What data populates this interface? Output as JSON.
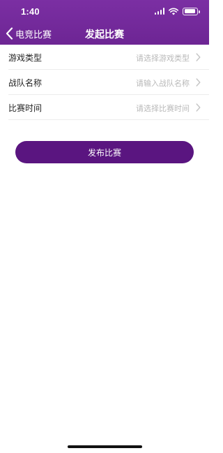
{
  "status_bar": {
    "time": "1:40",
    "icons": [
      "signal-icon",
      "wifi-icon",
      "battery-icon"
    ]
  },
  "nav": {
    "back_label": "电竞比赛",
    "title": "发起比赛"
  },
  "form": {
    "rows": [
      {
        "label": "游戏类型",
        "placeholder": "请选择游戏类型"
      },
      {
        "label": "战队名称",
        "placeholder": "请输入战队名称"
      },
      {
        "label": "比赛时间",
        "placeholder": "请选择比赛时间"
      }
    ]
  },
  "submit_label": "发布比赛",
  "colors": {
    "header": "#7b2fa3",
    "button": "#5a1580",
    "placeholder": "#b9b9b9"
  }
}
